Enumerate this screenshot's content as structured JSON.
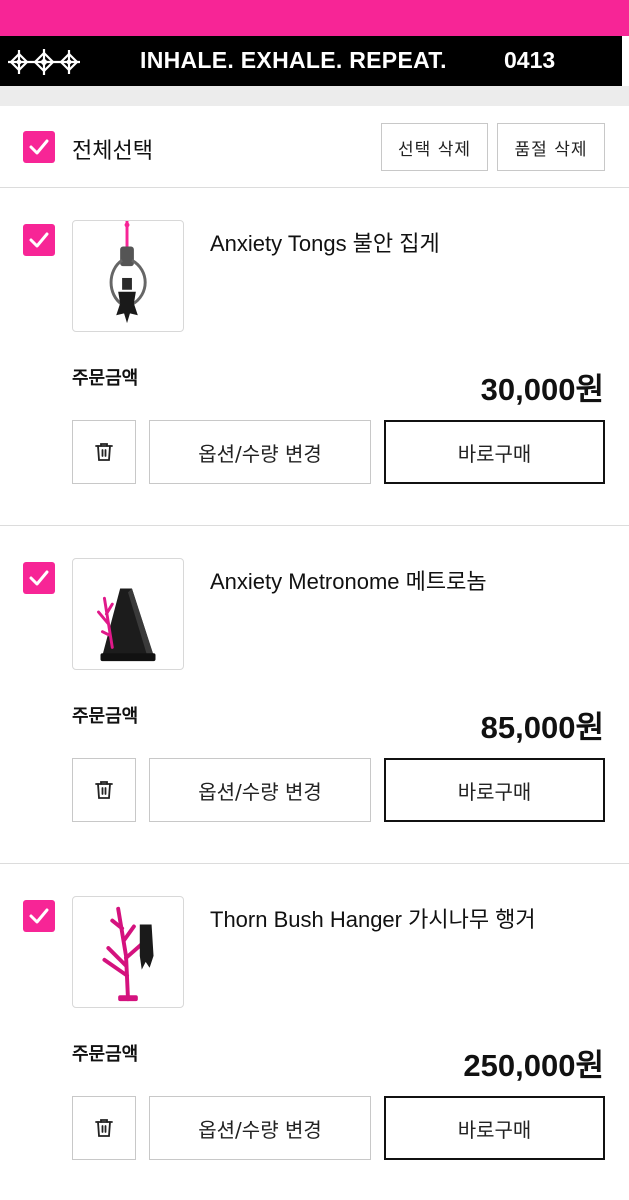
{
  "colors": {
    "accent": "#f72596",
    "banner_bg": "#000000",
    "divider": "#dcdcdc"
  },
  "banner": {
    "slogan": "INHALE. EXHALE. REPEAT.",
    "counter": "0413"
  },
  "cart_header": {
    "select_all_label": "전체선택",
    "select_all_checked": true,
    "delete_selected_label": "선택 삭제",
    "delete_soldout_label": "품절 삭제"
  },
  "items": [
    {
      "name": "Anxiety Tongs 불안 집게",
      "checked": true,
      "price_label": "주문금액",
      "price": "30,000원",
      "option_label": "옵션/수량 변경",
      "buy_label": "바로구매",
      "thumb_icon": "tongs-product-image"
    },
    {
      "name": "Anxiety Metronome 메트로놈",
      "checked": true,
      "price_label": "주문금액",
      "price": "85,000원",
      "option_label": "옵션/수량 변경",
      "buy_label": "바로구매",
      "thumb_icon": "metronome-product-image"
    },
    {
      "name": "Thorn Bush Hanger 가시나무 행거",
      "checked": true,
      "price_label": "주문금액",
      "price": "250,000원",
      "option_label": "옵션/수량 변경",
      "buy_label": "바로구매",
      "thumb_icon": "thorn-hanger-product-image"
    }
  ]
}
